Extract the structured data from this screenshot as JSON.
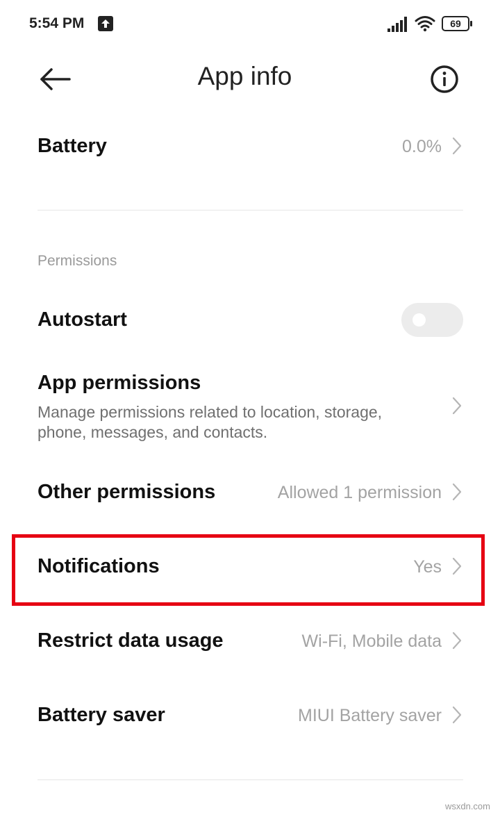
{
  "status_bar": {
    "time": "5:54 PM",
    "battery_level": "69",
    "icons": [
      "upload-icon",
      "signal-icon",
      "wifi-icon",
      "battery-icon"
    ]
  },
  "header": {
    "title": "App info",
    "back_icon": "arrow-left-icon",
    "info_icon": "info-circle-icon"
  },
  "battery_row": {
    "title": "Battery",
    "value": "0.0%"
  },
  "permissions_section": {
    "label": "Permissions"
  },
  "autostart_row": {
    "title": "Autostart",
    "enabled": false
  },
  "app_permissions_row": {
    "title": "App permissions",
    "subtitle_line1": "Manage permissions related to location, storage,",
    "subtitle_line2": "phone, messages, and contacts."
  },
  "other_permissions_row": {
    "title": "Other permissions",
    "value": "Allowed 1 permission"
  },
  "notifications_row": {
    "title": "Notifications",
    "value": "Yes",
    "highlighted": true
  },
  "restrict_data_row": {
    "title": "Restrict data usage",
    "value": "Wi-Fi, Mobile data"
  },
  "battery_saver_row": {
    "title": "Battery saver",
    "value": "MIUI Battery saver"
  },
  "watermark": "wsxdn.com",
  "colors": {
    "highlight": "#e60012",
    "value_text": "#a3a3a3",
    "toggle_off": "#ececec"
  }
}
